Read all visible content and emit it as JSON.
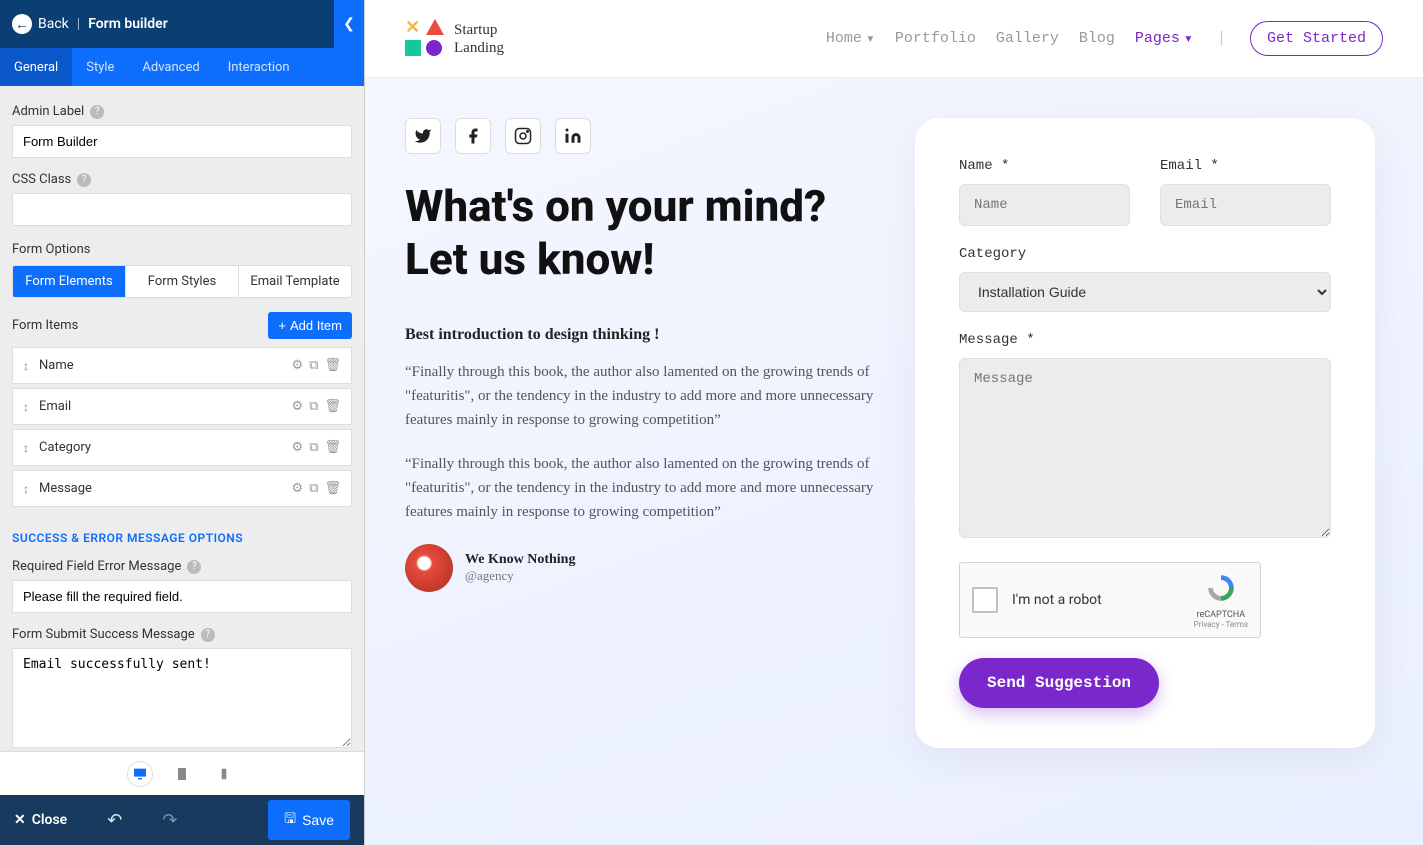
{
  "sidebar": {
    "back": "Back",
    "title": "Form builder",
    "tabs": [
      "General",
      "Style",
      "Advanced",
      "Interaction"
    ],
    "admin_label": "Admin Label",
    "admin_value": "Form Builder",
    "css_label": "CSS Class",
    "css_value": "",
    "form_options": "Form Options",
    "segs": [
      "Form Elements",
      "Form Styles",
      "Email Template"
    ],
    "form_items": "Form Items",
    "add_item": "Add Item",
    "items": [
      {
        "label": "Name"
      },
      {
        "label": "Email"
      },
      {
        "label": "Category"
      },
      {
        "label": "Message"
      }
    ],
    "section": "SUCCESS & ERROR MESSAGE OPTIONS",
    "err_label": "Required Field Error Message",
    "err_value": "Please fill the required field.",
    "succ_label": "Form Submit Success Message",
    "succ_value": "Email successfully sent!",
    "close": "Close",
    "save": "Save"
  },
  "nav": {
    "brand1": "Startup",
    "brand2": "Landing",
    "links": [
      "Home",
      "Portfolio",
      "Gallery",
      "Blog",
      "Pages"
    ],
    "cta": "Get Started"
  },
  "page": {
    "headline": "What's on your mind? Let us know!",
    "subhead": "Best introduction to design thinking !",
    "para1": "“Finally through this book, the author also lamented on the growing trends of \"featuritis\", or the tendency in the industry to add more and more unnecessary features mainly in response to growing competition”",
    "para2": "“Finally through this book, the author also lamented on the growing trends of \"featuritis\", or the tendency in the industry to add more and more unnecessary features mainly in response to growing competition”",
    "author_name": "We Know Nothing",
    "author_handle": "@agency"
  },
  "form": {
    "name_label": "Name *",
    "name_ph": "Name",
    "email_label": "Email *",
    "email_ph": "Email",
    "cat_label": "Category",
    "cat_value": "Installation Guide",
    "msg_label": "Message *",
    "msg_ph": "Message",
    "recaptcha": "I'm not a robot",
    "re_brand": "reCAPTCHA",
    "re_priv": "Privacy - Terms",
    "submit": "Send Suggestion"
  }
}
